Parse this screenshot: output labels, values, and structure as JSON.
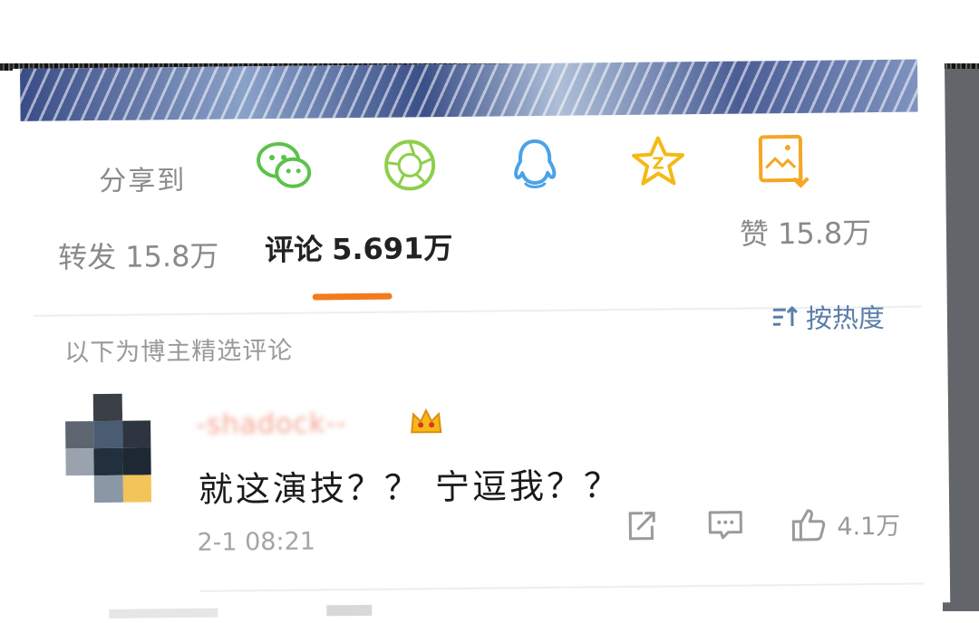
{
  "share": {
    "label": "分享到",
    "icons": [
      "wechat-icon",
      "moments-icon",
      "qq-icon",
      "qzone-icon",
      "save-image-icon"
    ],
    "colors": {
      "wechat": "#5cc24b",
      "moments": "#8ccf4a",
      "qq": "#4aa3e6",
      "qzone": "#f5b915",
      "save": "#f5a623"
    }
  },
  "stats": {
    "repost_label": "转发",
    "repost_count": "15.8万",
    "comment_label": "评论",
    "comment_count": "5.691万",
    "like_label": "赞",
    "like_count": "15.8万"
  },
  "accent_color": "#f27b1c",
  "filter_note": "以下为博主精选评论",
  "sort": {
    "label": "按热度",
    "color": "#5a7da8"
  },
  "comment": {
    "username": "-shadock--",
    "text": "就这演技？？ 宁逗我？？",
    "time": "2-1 08:21",
    "likes": "4.1万"
  }
}
